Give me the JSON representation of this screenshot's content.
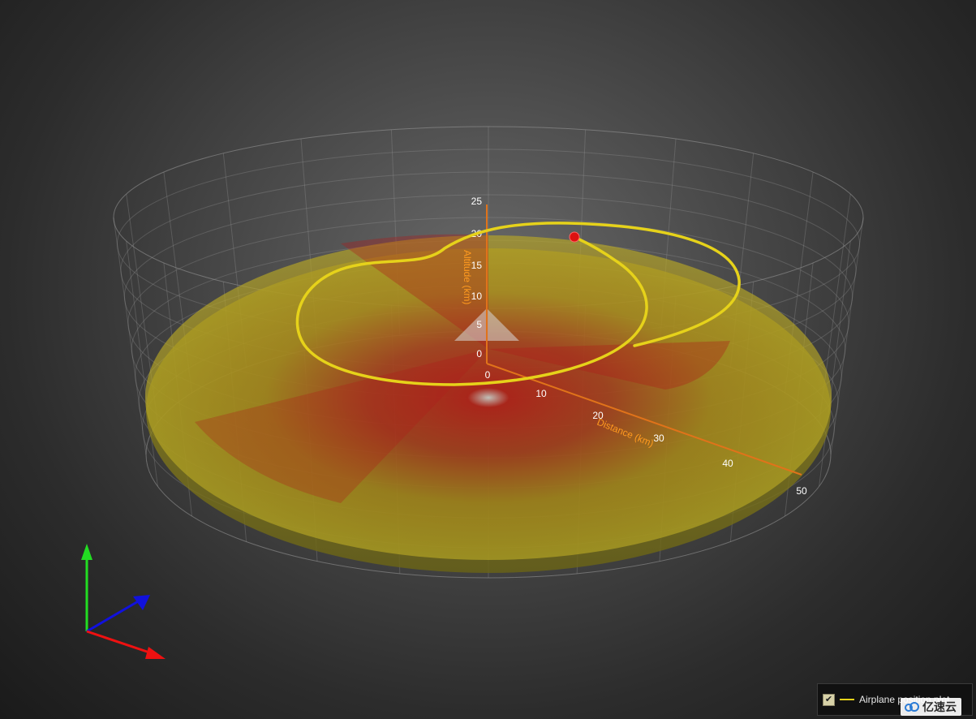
{
  "chart_data": {
    "type": "surface3d",
    "axes": {
      "altitude": {
        "title": "Altitude (km)",
        "ticks": [
          "0",
          "5",
          "10",
          "15",
          "20",
          "25"
        ],
        "range": [
          0,
          25
        ]
      },
      "distance": {
        "title": "Distance (km)",
        "ticks": [
          "0",
          "10",
          "20",
          "30",
          "40",
          "50"
        ],
        "range": [
          0,
          50
        ]
      }
    },
    "surface": {
      "shape": "disc",
      "colors": [
        "#ff1a1a",
        "#ffd21a"
      ],
      "opacity": 0.6
    },
    "series": [
      {
        "name": "Airplane position plot",
        "type": "line",
        "color": "#e6d21a",
        "marker_color": "#dd1111"
      }
    ],
    "legend_position": "bottom-right",
    "orientation_gizmo": {
      "x_color": "#ee1111",
      "y_color": "#22dd22",
      "z_color": "#1111dd"
    },
    "grid": true
  },
  "legend": {
    "items": [
      {
        "label": "Airplane position plot",
        "checked": true,
        "check_glyph": "✔",
        "color": "#e6d21a"
      }
    ]
  },
  "watermark": {
    "text": "亿速云"
  }
}
